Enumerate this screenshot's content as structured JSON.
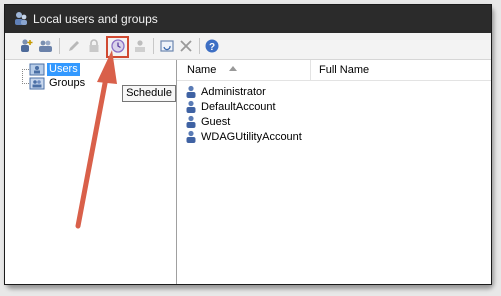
{
  "window": {
    "title": "Local users and groups"
  },
  "toolbar": {
    "buttons": [
      {
        "icon": "new-user-icon"
      },
      {
        "icon": "new-group-icon"
      },
      {
        "icon": "edit-pencil-icon"
      },
      {
        "icon": "lock-icon"
      },
      {
        "icon": "schedule-clock-icon",
        "highlighted": true
      },
      {
        "icon": "user-properties-icon"
      },
      {
        "icon": "refresh-window-icon"
      },
      {
        "icon": "delete-x-icon"
      },
      {
        "icon": "help-icon"
      }
    ],
    "tooltip": "Schedule",
    "highlight_color": "#d04a32"
  },
  "tree": {
    "items": [
      {
        "label": "Users",
        "selected": true
      },
      {
        "label": "Groups",
        "selected": false
      }
    ]
  },
  "list": {
    "columns": [
      "Name",
      "Full Name"
    ],
    "rows": [
      {
        "name": "Administrator",
        "full_name": ""
      },
      {
        "name": "DefaultAccount",
        "full_name": ""
      },
      {
        "name": "Guest",
        "full_name": ""
      },
      {
        "name": "WDAGUtilityAccount",
        "full_name": ""
      }
    ]
  },
  "colors": {
    "selection": "#3399ff",
    "titlebar": "#2b2b2b",
    "arrow": "#d9604a"
  }
}
